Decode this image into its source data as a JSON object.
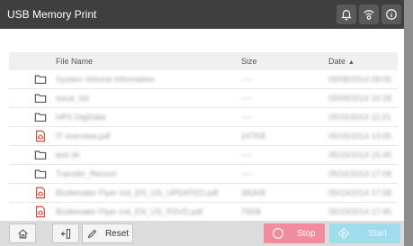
{
  "window": {
    "title": "USB Memory Print"
  },
  "titlebar_icons": [
    {
      "icon": "bell-icon"
    },
    {
      "icon": "wifi-settings-icon"
    },
    {
      "icon": "info-icon"
    }
  ],
  "table": {
    "headers": {
      "name": "File Name",
      "size": "Size",
      "date": "Date"
    },
    "sort": {
      "column": "date",
      "direction": "ascending",
      "indicator": "▲"
    },
    "rows": [
      {
        "type": "folder",
        "name": "System Volume Information",
        "size": "----",
        "date": "05/08/2014 09:05"
      },
      {
        "type": "folder",
        "name": "issue_list",
        "size": "----",
        "date": "05/09/2014 10:18"
      },
      {
        "type": "folder",
        "name": "HPS DigiData",
        "size": "----",
        "date": "05/15/2014 11:21"
      },
      {
        "type": "pdf",
        "name": "IT overview.pdf",
        "size": "247KB",
        "date": "05/15/2014 13:05"
      },
      {
        "type": "folder",
        "name": "test dir",
        "size": "----",
        "date": "05/15/2014 15:45"
      },
      {
        "type": "folder",
        "name": "Transfer_Record",
        "size": "----",
        "date": "05/16/2014 17:08"
      },
      {
        "type": "pdf",
        "name": "Bizdemater Flyer Ind_EN_US_UPDATED.pdf",
        "size": "382KB",
        "date": "05/19/2014 17:58"
      },
      {
        "type": "pdf",
        "name": "Bizdemater Flyer Ind_EN_US_RSVD.pdf",
        "size": "75KB",
        "date": "05/19/2014 17:45"
      }
    ]
  },
  "toolbar": {
    "home_icon": "home-icon",
    "usb_eject_icon": "usb-eject-icon",
    "reset_label": "Reset",
    "stop_label": "Stop",
    "start_label": "Start"
  },
  "colors": {
    "titlebar": "#3f3f3f",
    "stop": "#f28b9b",
    "start": "#9fdcec",
    "pdf_icon": "#d9362b"
  }
}
